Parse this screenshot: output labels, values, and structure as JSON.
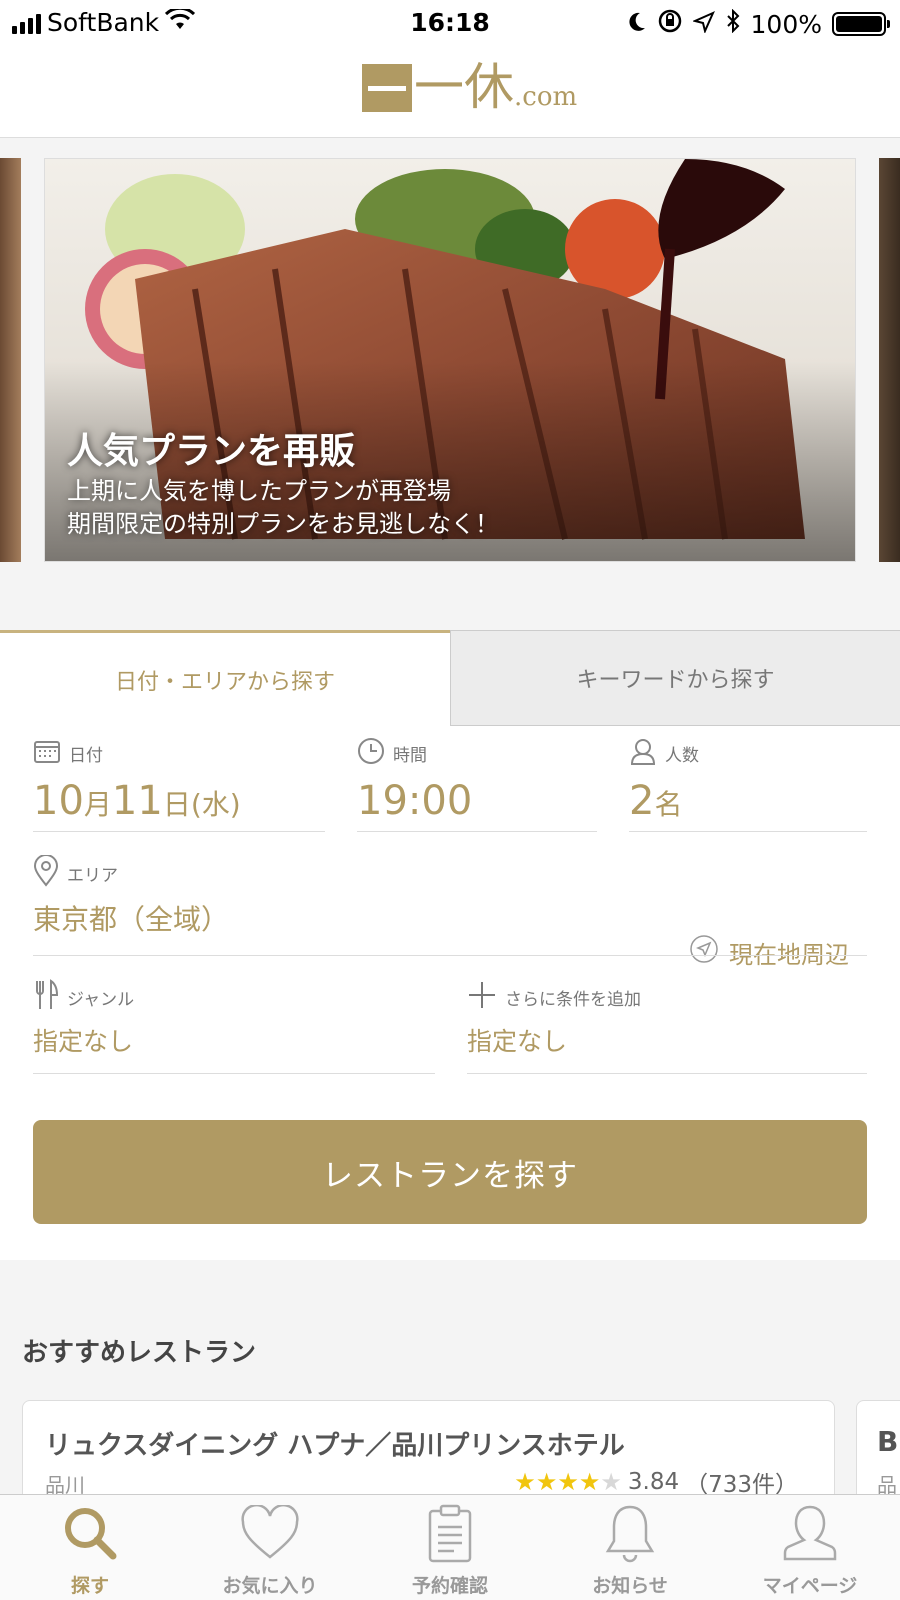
{
  "status_bar": {
    "carrier": "SoftBank",
    "time": "16:18",
    "battery": "100%",
    "battery_level_pct": 100,
    "icons": [
      "signal-icon",
      "wifi-icon",
      "moon-icon",
      "rotation-lock-icon",
      "location-icon",
      "bluetooth-icon",
      "battery-icon"
    ]
  },
  "header": {
    "logo_kanji": "一休",
    "logo_suffix": ".com"
  },
  "banner": {
    "title": "人気プランを再販",
    "subtitle_line1": "上期に人気を博したプランが再登場",
    "subtitle_line2": "期間限定の特別プランをお見逃しなく！"
  },
  "tabs": [
    {
      "label": "日付・エリアから探す",
      "active": true
    },
    {
      "label": "キーワードから探す",
      "active": false
    }
  ],
  "form": {
    "date": {
      "label": "日付",
      "month": "10",
      "month_unit": "月",
      "day": "11",
      "day_unit": "日",
      "weekday": "(水)"
    },
    "time": {
      "label": "時間",
      "value": "19:00"
    },
    "people": {
      "label": "人数",
      "count": "2",
      "unit": "名"
    },
    "area": {
      "label": "エリア",
      "value": "東京都（全域）",
      "nearby_label": "現在地周辺"
    },
    "genre": {
      "label": "ジャンル",
      "value": "指定なし"
    },
    "more": {
      "label": "さらに条件を追加",
      "value": "指定なし"
    },
    "search_button": "レストランを探す"
  },
  "recommendations": {
    "title": "おすすめレストラン",
    "cards": [
      {
        "name": "リュクスダイニング ハプナ／品川プリンスホテル",
        "area": "品川",
        "rating": "3.84",
        "reviews": "（733件）",
        "stars_filled": 4
      },
      {
        "name": "B",
        "area": "品"
      }
    ]
  },
  "tabbar": [
    {
      "label": "探す",
      "icon": "search-icon",
      "active": true
    },
    {
      "label": "お気に入り",
      "icon": "heart-icon",
      "active": false
    },
    {
      "label": "予約確認",
      "icon": "clipboard-icon",
      "active": false
    },
    {
      "label": "お知らせ",
      "icon": "bell-icon",
      "active": false
    },
    {
      "label": "マイページ",
      "icon": "user-icon",
      "active": false
    }
  ],
  "colors": {
    "accent": "#b09a63",
    "star": "#f1c50e"
  }
}
